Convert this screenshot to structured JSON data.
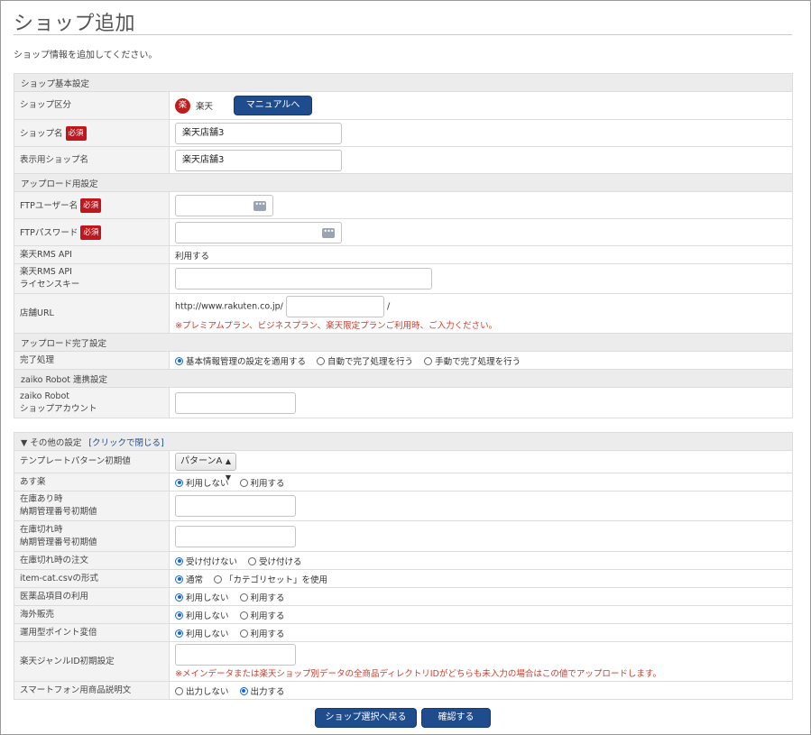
{
  "page": {
    "title": "ショップ追加",
    "intro": "ショップ情報を追加してください。"
  },
  "required_badge": "必須",
  "basic": {
    "section_title": "ショップ基本設定",
    "shop_type": {
      "label": "ショップ区分",
      "badge_glyph": "楽",
      "value": "楽天",
      "manual_button": "マニュアルへ"
    },
    "shop_name": {
      "label": "ショップ名",
      "value": "楽天店舗3"
    },
    "display_name": {
      "label": "表示用ショップ名",
      "value": "楽天店舗3"
    }
  },
  "upload": {
    "section_title": "アップロード用設定",
    "ftp_user": {
      "label": "FTPユーザー名",
      "value": ""
    },
    "ftp_password": {
      "label": "FTPパスワード",
      "value": ""
    },
    "rms_api": {
      "label": "楽天RMS API",
      "value": "利用する"
    },
    "license_key": {
      "label_line1": "楽天RMS API",
      "label_line2": "ライセンスキー",
      "value": ""
    },
    "shop_url": {
      "label": "店舗URL",
      "prefix": "http://www.rakuten.co.jp/",
      "suffix": "/",
      "value": "",
      "note": "※プレミアムプラン、ビジネスプラン、楽天限定プランご利用時、ご入力ください。"
    }
  },
  "upload_complete": {
    "section_title": "アップロード完了設定",
    "label": "完了処理",
    "options": [
      "基本情報管理の設定を適用する",
      "自動で完了処理を行う",
      "手動で完了処理を行う"
    ],
    "selected": 0
  },
  "zaiko": {
    "section_title": "zaiko Robot 連携設定",
    "label_line1": "zaiko Robot",
    "label_line2": "ショップアカウント",
    "value": ""
  },
  "other": {
    "section_title": "▼ その他の設定",
    "toggle_link": "[クリックで閉じる]",
    "template": {
      "label": "テンプレートパターン初期値",
      "selected": "パターンA"
    },
    "asuraku": {
      "label": "あす楽",
      "options": [
        "利用しない",
        "利用する"
      ],
      "selected": 0
    },
    "instock": {
      "label_line1": "在庫あり時",
      "label_line2": "納期管理番号初期値",
      "value": ""
    },
    "outofstock": {
      "label_line1": "在庫切れ時",
      "label_line2": "納期管理番号初期値",
      "value": ""
    },
    "oos_order": {
      "label": "在庫切れ時の注文",
      "options": [
        "受け付けない",
        "受け付ける"
      ],
      "selected": 0
    },
    "item_cat": {
      "label": "item-cat.csvの形式",
      "options": [
        "通常",
        "「カテゴリセット」を使用"
      ],
      "selected": 0
    },
    "medicine": {
      "label": "医薬品項目の利用",
      "options": [
        "利用しない",
        "利用する"
      ],
      "selected": 0
    },
    "overseas": {
      "label": "海外販売",
      "options": [
        "利用しない",
        "利用する"
      ],
      "selected": 0
    },
    "points": {
      "label": "運用型ポイント変倍",
      "options": [
        "利用しない",
        "利用する"
      ],
      "selected": 0
    },
    "genre": {
      "label": "楽天ジャンルID初期設定",
      "value": "",
      "note": "※メインデータまたは楽天ショップ別データの全商品ディレクトリIDがどちらも未入力の場合はこの値でアップロードします。"
    },
    "smartphone": {
      "label": "スマートフォン用商品説明文",
      "options": [
        "出力しない",
        "出力する"
      ],
      "selected": 1
    }
  },
  "footer": {
    "back_button": "ショップ選択へ戻る",
    "confirm_button": "確認する"
  },
  "colors": {
    "primary_button": "#1f4c8c",
    "required_badge": "#c0161e",
    "note_text": "#d23a2a",
    "radio_selected": "#1a66d2"
  }
}
